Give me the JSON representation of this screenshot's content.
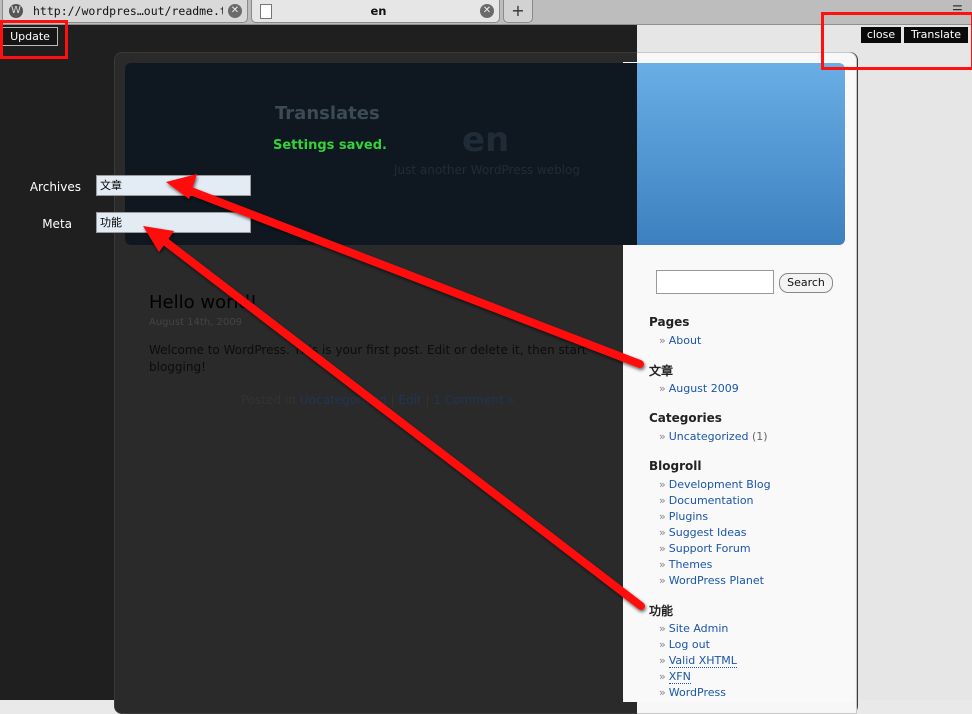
{
  "browser": {
    "tabs": [
      {
        "title": "http://wordpres…out/readme.txt"
      },
      {
        "title": "en"
      }
    ],
    "new_tab_symbol": "+"
  },
  "toolbar": {
    "update_label": "Update",
    "close_label": "close",
    "translate_label": "Translate"
  },
  "translate_panel": {
    "heading": "Translates",
    "status": "Settings saved.",
    "fields": [
      {
        "label": "Archives",
        "value": "文章"
      },
      {
        "label": "Meta",
        "value": "功能"
      }
    ]
  },
  "blog": {
    "name": "en",
    "tagline": "Just another WordPress weblog"
  },
  "post": {
    "title": "Hello world!",
    "date": "August 14th, 2009",
    "body": "Welcome to WordPress. This is your first post. Edit or delete it, then start blogging!",
    "meta_prefix": "Posted in",
    "category": "Uncategorized",
    "sep1": "|",
    "edit": "Edit",
    "sep2": "|",
    "comments": "1 Comment »"
  },
  "sidebar": {
    "search_button": "Search",
    "pages_heading": "Pages",
    "pages": [
      "About"
    ],
    "archives_heading": "文章",
    "archives": [
      "August 2009"
    ],
    "categories_heading": "Categories",
    "categories": [
      {
        "name": "Uncategorized",
        "count": "(1)"
      }
    ],
    "blogroll_heading": "Blogroll",
    "blogroll": [
      "Development Blog",
      "Documentation",
      "Plugins",
      "Suggest Ideas",
      "Support Forum",
      "Themes",
      "WordPress Planet"
    ],
    "meta_heading": "功能",
    "meta": [
      "Site Admin",
      "Log out",
      "Valid XHTML",
      "XFN",
      "WordPress"
    ]
  },
  "colors": {
    "highlight_red": "#ff1010",
    "saved_green": "#33d33a",
    "link_blue": "#1a56a8"
  }
}
